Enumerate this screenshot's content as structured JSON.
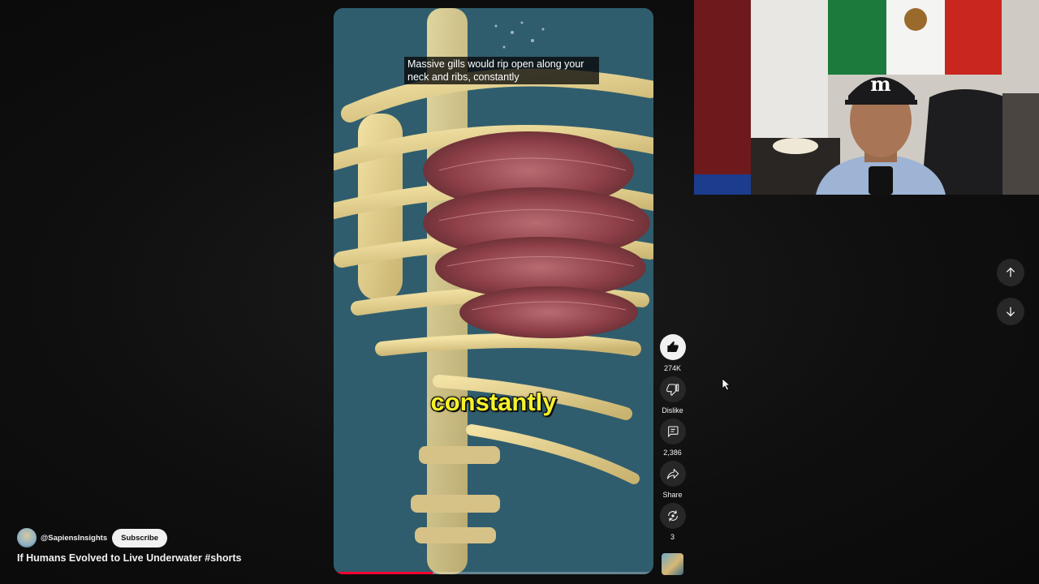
{
  "video": {
    "caption_line": "Massive gills would rip open along your neck and ribs, constantly",
    "big_caption": "constantly",
    "progress": 0.31
  },
  "actions": {
    "like": {
      "icon": "thumbs-up-icon",
      "label": "274K"
    },
    "dislike": {
      "icon": "thumbs-down-icon",
      "label": "Dislike"
    },
    "comments": {
      "icon": "comment-icon",
      "label": "2,386"
    },
    "share": {
      "icon": "share-icon",
      "label": "Share"
    },
    "remix": {
      "icon": "remix-icon",
      "label": "3"
    }
  },
  "channel": {
    "handle": "@SapiensInsights",
    "subscribe_label": "Subscribe"
  },
  "video_title": "If Humans Evolved to Live Underwater #shorts",
  "navigation": {
    "prev_icon": "arrow-up-icon",
    "next_icon": "arrow-down-icon"
  },
  "colors": {
    "background": "#0f0f0f",
    "progress": "#ff0033",
    "caption_yellow": "#f4f22a",
    "button_bg": "#272727"
  }
}
